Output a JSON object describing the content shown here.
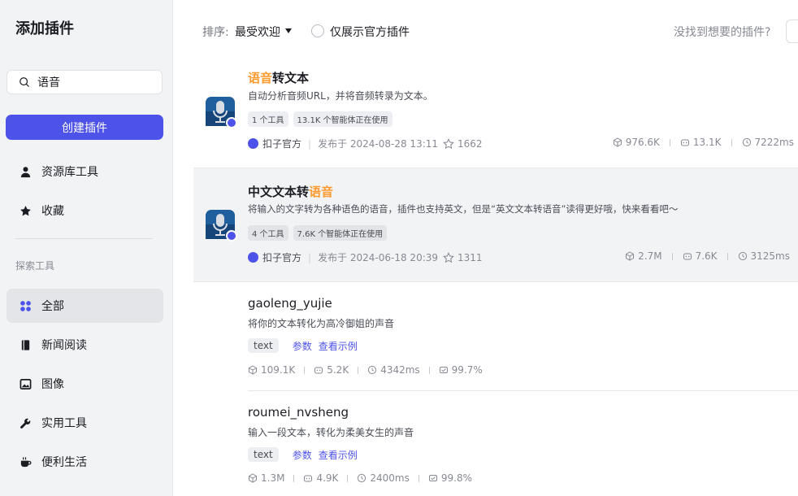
{
  "sidebar": {
    "title": "添加插件",
    "search": {
      "value": "语音",
      "placeholder": ""
    },
    "create_label": "创建插件",
    "items": [
      {
        "label": "资源库工具",
        "icon": "person-icon"
      },
      {
        "label": "收藏",
        "icon": "star-icon"
      }
    ],
    "section_label": "探索工具",
    "categories": [
      {
        "label": "全部",
        "icon": "grid-icon",
        "active": true
      },
      {
        "label": "新闻阅读",
        "icon": "book-icon"
      },
      {
        "label": "图像",
        "icon": "image-icon"
      },
      {
        "label": "实用工具",
        "icon": "wrench-icon"
      },
      {
        "label": "便利生活",
        "icon": "cup-icon"
      }
    ]
  },
  "topbar": {
    "sort_label": "排序:",
    "sort_value": "最受欢迎",
    "official_only_label": "仅展示官方插件",
    "not_found_text": "没找到想要的插件?"
  },
  "plugins": [
    {
      "title_highlight": "语音",
      "title_rest": "转文本",
      "description": "自动分析音频URL，并将音频转录为文本。",
      "tags": [
        "1 个工具",
        "13.1K 个智能体正在使用"
      ],
      "publisher": "扣子官方",
      "published": "发布于 2024-08-28 13:11",
      "favorites": "1662",
      "stats": {
        "calls": "976.6K",
        "bots": "13.1K",
        "latency": "7222ms"
      }
    },
    {
      "title_prefix": "中文文本转",
      "title_highlight": "语音",
      "description": "将输入的文字转为各种语色的语音，插件也支持英文，但是“英文文本转语音”读得更好哦，快来看看吧～",
      "tags": [
        "4 个工具",
        "7.6K 个智能体正在使用"
      ],
      "publisher": "扣子官方",
      "published": "发布于 2024-06-18 20:39",
      "favorites": "1311",
      "stats": {
        "calls": "2.7M",
        "bots": "7.6K",
        "latency": "3125ms"
      }
    }
  ],
  "tools": [
    {
      "name": "gaoleng_yujie",
      "description": "将你的文本转化为高冷御姐的声音",
      "param": "text",
      "params_link": "参数",
      "example_link": "查看示例",
      "stats": {
        "calls": "109.1K",
        "bots": "5.2K",
        "latency": "4342ms",
        "success": "99.7%"
      }
    },
    {
      "name": "roumei_nvsheng",
      "description": "输入一段文本，转化为柔美女生的声音",
      "param": "text",
      "params_link": "参数",
      "example_link": "查看示例",
      "stats": {
        "calls": "1.3M",
        "bots": "4.9K",
        "latency": "2400ms",
        "success": "99.8%"
      }
    }
  ],
  "colors": {
    "accent": "#4d53e8",
    "highlight": "#ff9a2e",
    "sidebar_bg": "#f2f3f5"
  }
}
